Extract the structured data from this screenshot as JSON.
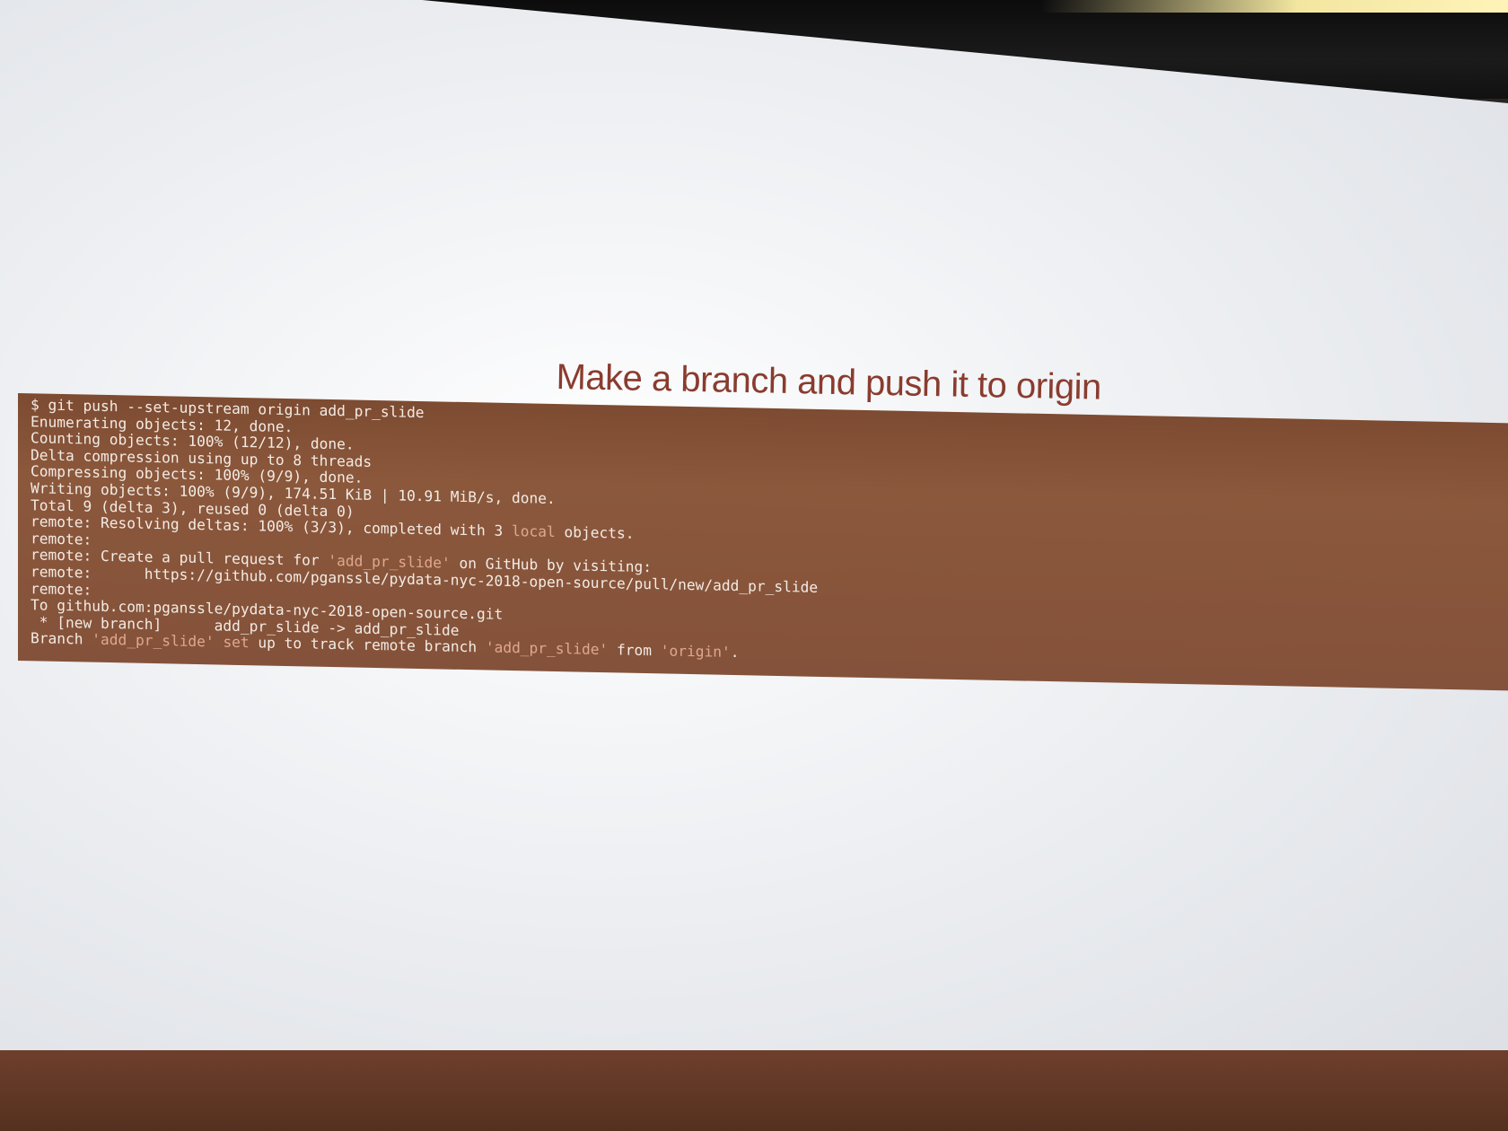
{
  "slide": {
    "title": "Make a branch and push it to origin"
  },
  "terminal": {
    "lines": [
      [
        {
          "text": "$ git push --set-upstream origin add_pr_slide"
        }
      ],
      [
        {
          "text": "Enumerating objects: 12, done."
        }
      ],
      [
        {
          "text": "Counting objects: 100% (12/12), done."
        }
      ],
      [
        {
          "text": "Delta compression using up to 8 threads"
        }
      ],
      [
        {
          "text": "Compressing objects: 100% (9/9), done."
        }
      ],
      [
        {
          "text": "Writing objects: 100% (9/9), 174.51 KiB | 10.91 MiB/s, done."
        }
      ],
      [
        {
          "text": "Total 9 (delta 3), reused 0 (delta 0)"
        }
      ],
      [
        {
          "text": "remote: Resolving deltas: 100% (3/3), completed with 3 "
        },
        {
          "text": "local",
          "hl": true
        },
        {
          "text": " objects."
        }
      ],
      [
        {
          "text": "remote:"
        }
      ],
      [
        {
          "text": "remote: Create a pull request for "
        },
        {
          "text": "'add_pr_slide'",
          "hl": true
        },
        {
          "text": " on GitHub by visiting:"
        }
      ],
      [
        {
          "text": "remote:      https://github.com/pganssle/pydata-nyc-2018-open-source/pull/new/add_pr_slide"
        }
      ],
      [
        {
          "text": "remote:"
        }
      ],
      [
        {
          "text": "To github.com:pganssle/pydata-nyc-2018-open-source.git"
        }
      ],
      [
        {
          "text": " * [new branch]      add_pr_slide -> add_pr_slide"
        }
      ],
      [
        {
          "text": "Branch "
        },
        {
          "text": "'add_pr_slide'",
          "hl": true
        },
        {
          "text": " "
        },
        {
          "text": "set",
          "hl": true
        },
        {
          "text": " up to track remote branch "
        },
        {
          "text": "'add_pr_slide'",
          "hl": true
        },
        {
          "text": " from "
        },
        {
          "text": "'origin'",
          "hl": true
        },
        {
          "text": "."
        }
      ]
    ],
    "colors": {
      "background": "#84523a",
      "text": "#f3ebe4",
      "highlight": "#e0a78e"
    }
  },
  "colors": {
    "title": "#8a3c2f",
    "screen": "#eef0f3",
    "bezel": "#111111"
  }
}
